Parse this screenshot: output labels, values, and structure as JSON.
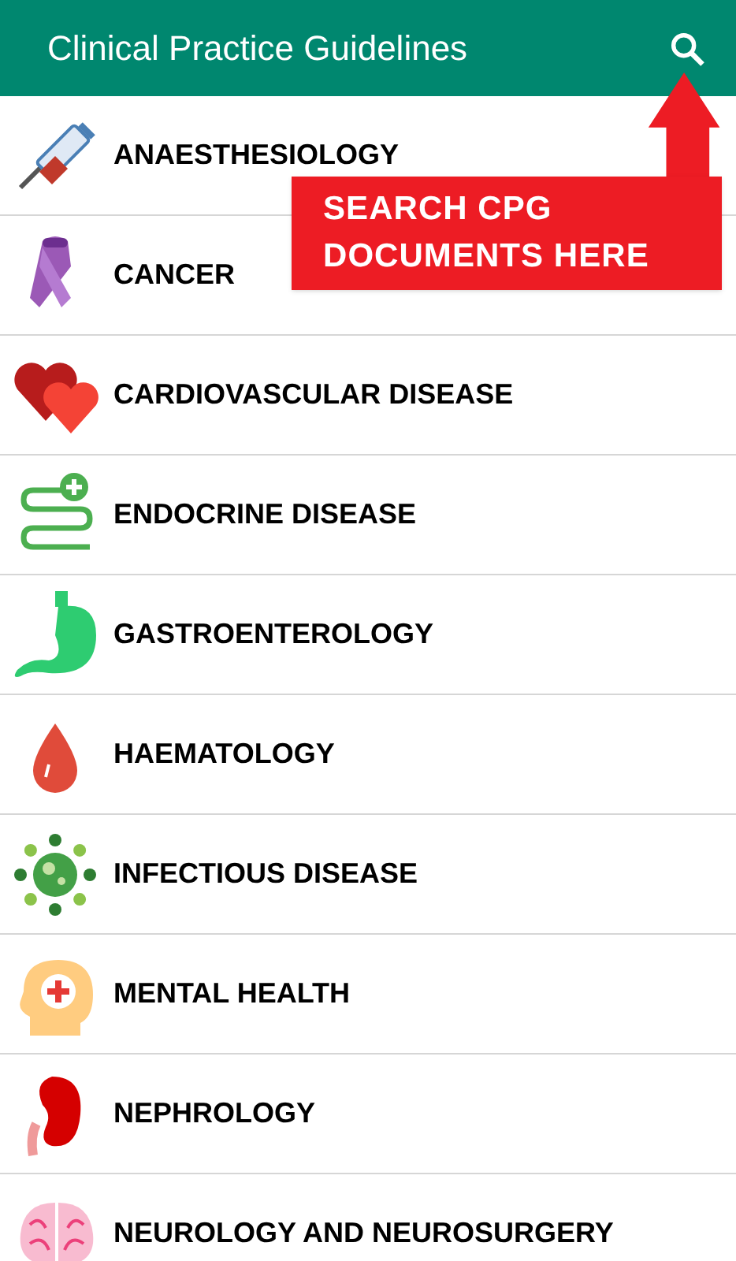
{
  "app_bar": {
    "title": "Clinical Practice Guidelines"
  },
  "categories": [
    {
      "label": "ANAESTHESIOLOGY"
    },
    {
      "label": "CANCER"
    },
    {
      "label": "CARDIOVASCULAR DISEASE"
    },
    {
      "label": "ENDOCRINE DISEASE"
    },
    {
      "label": "GASTROENTEROLOGY"
    },
    {
      "label": "HAEMATOLOGY"
    },
    {
      "label": "INFECTIOUS DISEASE"
    },
    {
      "label": "MENTAL HEALTH"
    },
    {
      "label": "NEPHROLOGY"
    },
    {
      "label": "NEUROLOGY AND NEUROSURGERY"
    }
  ],
  "callout": {
    "lines": [
      "SEARCH CPG",
      "DOCUMENTS HERE"
    ]
  }
}
